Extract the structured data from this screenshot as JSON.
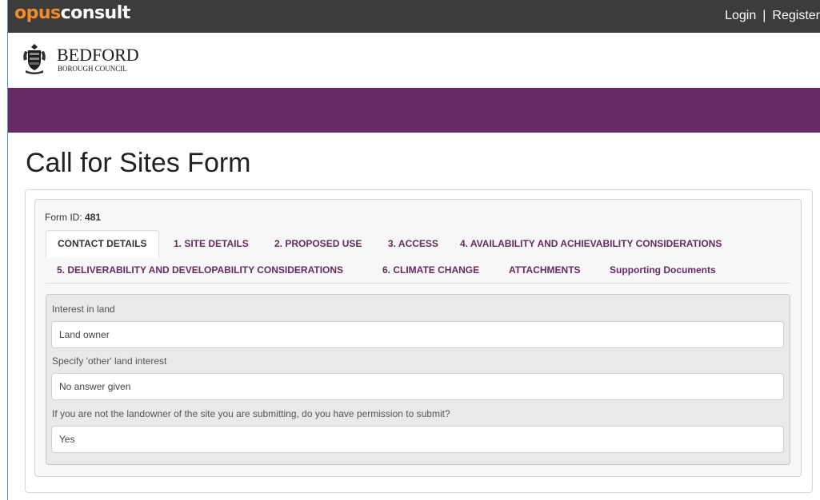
{
  "header": {
    "brand_opus": "opus",
    "brand_consult": "consult",
    "login": "Login",
    "separator": "|",
    "register": "Register"
  },
  "council": {
    "name": "BEDFORD",
    "subtitle": "BOROUGH COUNCIL"
  },
  "page": {
    "title": "Call for Sites Form"
  },
  "form": {
    "id_label": "Form ID:",
    "id_value": "481",
    "tabs": [
      "CONTACT DETAILS",
      "1. SITE DETAILS",
      "2. PROPOSED USE",
      "3. ACCESS",
      "4. AVAILABILITY AND ACHIEVABILITY CONSIDERATIONS",
      "5. DELIVERABILITY AND DEVELOPABILITY CONSIDERATIONS",
      "6. CLIMATE CHANGE",
      "ATTACHMENTS",
      "Supporting Documents"
    ],
    "active_tab": "CONTACT DETAILS",
    "fields": [
      {
        "label": "Interest in land",
        "value": "Land owner"
      },
      {
        "label": "Specify 'other' land interest",
        "value": "No answer given"
      },
      {
        "label": "If you are not the landowner of the site you are submitting, do you have permission to submit?",
        "value": "Yes"
      }
    ]
  },
  "colors": {
    "accent_purple": "#672964",
    "topbar": "#3c3c3c",
    "brand_orange": "#f28c28"
  },
  "icons": {
    "crest": "coat-of-arms-icon"
  }
}
